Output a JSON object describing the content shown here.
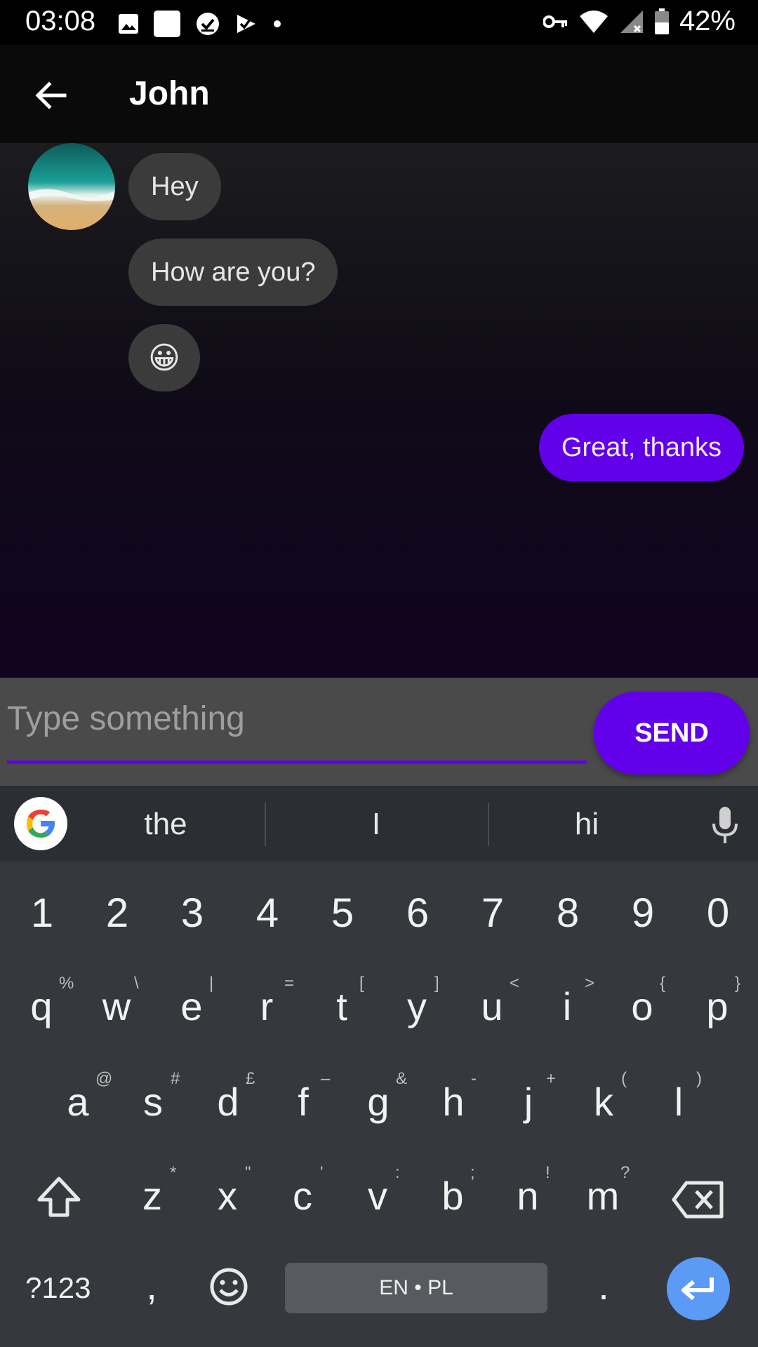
{
  "status_bar": {
    "time": "03:08",
    "battery_percent": "42%",
    "icons_left": [
      "image-icon",
      "square-icon",
      "check-circle-icon",
      "check-flag-icon",
      "dot-icon"
    ],
    "icons_right": [
      "key-icon",
      "wifi-icon",
      "signal-x-icon",
      "battery-icon"
    ]
  },
  "app_bar": {
    "back_icon": "arrow-left-icon",
    "title": "John"
  },
  "messages": [
    {
      "direction": "in",
      "text": "Hey"
    },
    {
      "direction": "in",
      "text": "How are you?"
    },
    {
      "direction": "in",
      "text": "😀"
    },
    {
      "direction": "out",
      "text": "Great, thanks"
    }
  ],
  "composer": {
    "placeholder": "Type something",
    "value": "",
    "send_label": "SEND"
  },
  "keyboard": {
    "suggestions": [
      "the",
      "I",
      "hi"
    ],
    "number_row": [
      "1",
      "2",
      "3",
      "4",
      "5",
      "6",
      "7",
      "8",
      "9",
      "0"
    ],
    "row1": [
      "q",
      "w",
      "e",
      "r",
      "t",
      "y",
      "u",
      "i",
      "o",
      "p"
    ],
    "row1_hints": [
      "%",
      "\\",
      "|",
      "=",
      "[",
      "]",
      "<",
      ">",
      "{",
      "}"
    ],
    "row2": [
      "a",
      "s",
      "d",
      "f",
      "g",
      "h",
      "j",
      "k",
      "l"
    ],
    "row2_hints": [
      "@",
      "#",
      "£",
      "–",
      "&",
      "-",
      "+",
      "(",
      ")"
    ],
    "row3": [
      "z",
      "x",
      "c",
      "v",
      "b",
      "n",
      "m"
    ],
    "row3_hints": [
      "*",
      "\"",
      "'",
      ":",
      ";",
      "!",
      "?"
    ],
    "symbols_label": "?123",
    "comma": ",",
    "period": ".",
    "space_label": "EN • PL",
    "colors": {
      "accent": "#6200ea",
      "enter": "#5b9af5"
    }
  }
}
